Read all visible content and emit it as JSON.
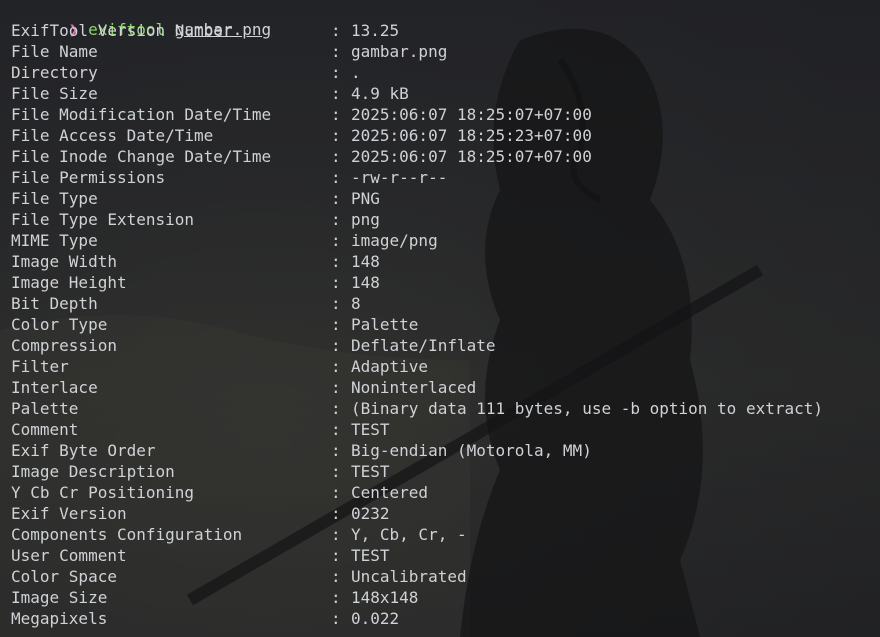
{
  "prompt": {
    "symbol": "❯",
    "command": "exiftool",
    "argument": "gambar.png"
  },
  "separator": ":",
  "rows": [
    {
      "key": "ExifTool Version Number",
      "value": "13.25"
    },
    {
      "key": "File Name",
      "value": "gambar.png"
    },
    {
      "key": "Directory",
      "value": "."
    },
    {
      "key": "File Size",
      "value": "4.9 kB"
    },
    {
      "key": "File Modification Date/Time",
      "value": "2025:06:07 18:25:07+07:00"
    },
    {
      "key": "File Access Date/Time",
      "value": "2025:06:07 18:25:23+07:00"
    },
    {
      "key": "File Inode Change Date/Time",
      "value": "2025:06:07 18:25:07+07:00"
    },
    {
      "key": "File Permissions",
      "value": "-rw-r--r--"
    },
    {
      "key": "File Type",
      "value": "PNG"
    },
    {
      "key": "File Type Extension",
      "value": "png"
    },
    {
      "key": "MIME Type",
      "value": "image/png"
    },
    {
      "key": "Image Width",
      "value": "148"
    },
    {
      "key": "Image Height",
      "value": "148"
    },
    {
      "key": "Bit Depth",
      "value": "8"
    },
    {
      "key": "Color Type",
      "value": "Palette"
    },
    {
      "key": "Compression",
      "value": "Deflate/Inflate"
    },
    {
      "key": "Filter",
      "value": "Adaptive"
    },
    {
      "key": "Interlace",
      "value": "Noninterlaced"
    },
    {
      "key": "Palette",
      "value": "(Binary data 111 bytes, use -b option to extract)"
    },
    {
      "key": "Comment",
      "value": "TEST"
    },
    {
      "key": "Exif Byte Order",
      "value": "Big-endian (Motorola, MM)"
    },
    {
      "key": "Image Description",
      "value": "TEST"
    },
    {
      "key": "Y Cb Cr Positioning",
      "value": "Centered"
    },
    {
      "key": "Exif Version",
      "value": "0232"
    },
    {
      "key": "Components Configuration",
      "value": "Y, Cb, Cr, -"
    },
    {
      "key": "User Comment",
      "value": "TEST"
    },
    {
      "key": "Color Space",
      "value": "Uncalibrated"
    },
    {
      "key": "Image Size",
      "value": "148x148"
    },
    {
      "key": "Megapixels",
      "value": "0.022"
    }
  ]
}
